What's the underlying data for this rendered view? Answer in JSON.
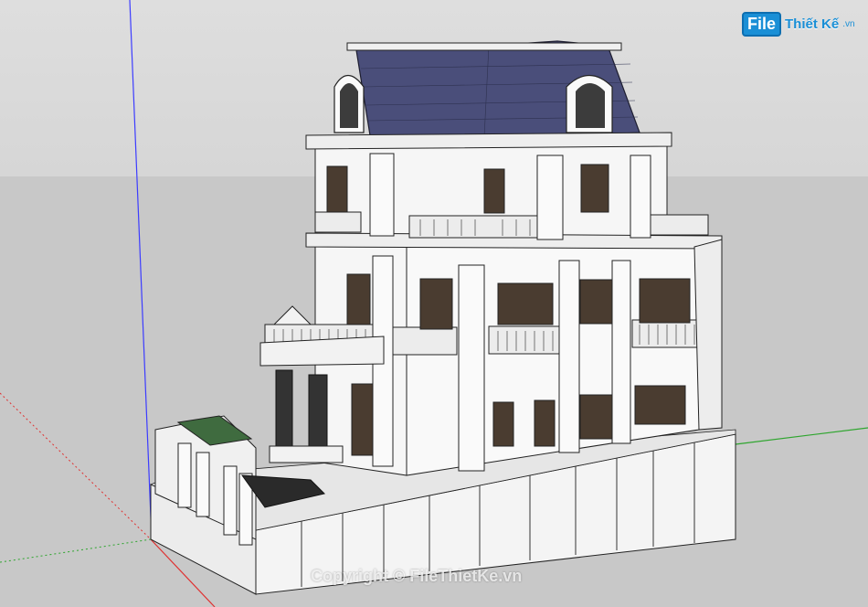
{
  "watermark": {
    "logo_file": "File",
    "logo_name": "Thiết Kế",
    "logo_tld": ".vn",
    "copyright": "Copyright © FileThietKe.vn"
  },
  "colors": {
    "sky": "#dcdcdc",
    "ground": "#c8c8c8",
    "roof": "#4a4e7a",
    "wall": "#f5f5f5",
    "axis_blue": "#3c3cff",
    "axis_green": "#2ea52e",
    "axis_red": "#e03030",
    "glass": "#5a4a3a"
  }
}
